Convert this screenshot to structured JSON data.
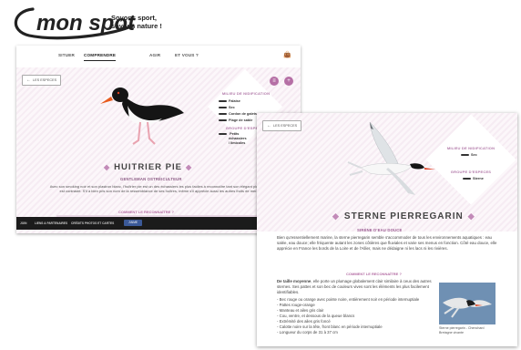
{
  "logo": {
    "brand": "mon spot",
    "tagline_1": "Soyons sport,",
    "tagline_2": "soyons nature !"
  },
  "colors": {
    "accent": "#b56fa5",
    "hero_pink": "#f6ecf3",
    "footer": "#1b1b1b",
    "facebook": "#3b5998"
  },
  "screen1": {
    "nav": {
      "items": [
        "SITUER",
        "COMPRENDRE",
        "AGIR",
        "ET VOUS ?"
      ],
      "active": "COMPRENDRE",
      "bag_icon": "shopping-bag-icon"
    },
    "back_label": "LES ESPECES",
    "habitat_title": "MILIEU DE NIDIFICATION",
    "habitats": [
      "Falaise",
      "Sec",
      "Cordon de galets",
      "Plage de sable"
    ],
    "food_title": "GROUPE D'ESPECES",
    "food_items": [
      "Petits",
      "échassiers",
      "/ limicoles"
    ],
    "title": "HUITRIER PIE",
    "subtitle": "GENTLEMAN OSTRÉICULTEUR",
    "body": "Avec son smoking noir et son plastron blanc, l'huîtrier pie est un des échassiers les plus faciles à reconnaître tant son élégant plumage est contrasté. S'il a bien pris son nom de la ressemblance de ses huîtres, même s'il apprécie aussi les autres fruits de mer.",
    "recognize": "COMMENT LE RECONNAÎTRE ?",
    "footer": [
      "JOIN",
      "LIENS & PARTENAIRES",
      "CRÉDITS PHOTOS ET CARTES"
    ],
    "fb_label": "J'AIME"
  },
  "screen2": {
    "back_label": "LES ESPECES",
    "habitat_title": "MILIEU DE NIDIFICATION",
    "habitat_item": "Sec",
    "food_title": "GROUPE D'ESPECES",
    "food_item": "Sterne",
    "title": "STERNE PIERREGARIN",
    "subtitle": "SIRÈNE D'EAU DOUCE",
    "intro": "Bien qu'essentiellement marine, la sterne pierregarin semble s'accommoder de tous les environnements aquatiques : eau salée, eau douce; elle fréquente autant les zones côtières que fluviales et varie ses menus en fonction. Côté eau douce, elle apprécie en France les bords de la Loire et de l'Allier, mais ne dédaigne ni les lacs ni les rivières.",
    "recognize": "COMMENT LE RECONNAÎTRE ?",
    "description_bold": "De taille moyenne",
    "description_rest": ", elle porte un plumage globalement clair similaire à ceux des autres sternes. Ses pattes et son bec de couleurs vives sont les éléments les plus facilement identifiables.",
    "bullets": [
      "Bec rouge ou orange avec pointe noire, entièrement noir en période internuptiale",
      "Pattes rouge-orange",
      "Manteau et ailes gris clair",
      "Cou, ventre, et dessous de la queue blancs",
      "Extrémité des ailes gris foncé",
      "Calotte noire sur la tête, front blanc en période internuptiale",
      "Longueur du corps de 31 à 37 cm"
    ],
    "photo_caption_1": "Sterne pierregarin - Chenchard",
    "photo_caption_2": "Bretagne vivante"
  }
}
